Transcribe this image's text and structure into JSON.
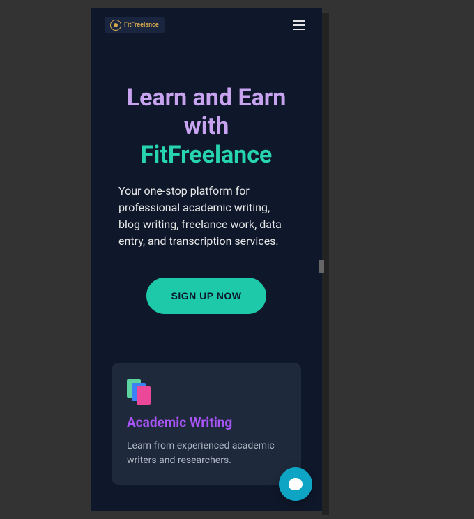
{
  "header": {
    "logo_text": "FitFreelance"
  },
  "hero": {
    "title_line1": "Learn and Earn with",
    "title_line2": "FitFreelance",
    "description": "Your one-stop platform for professional academic writing, blog writing, freelance work, data entry, and transcription services.",
    "cta_label": "SIGN UP NOW"
  },
  "cards": [
    {
      "title": "Academic Writing",
      "description": "Learn from experienced academic writers and researchers."
    }
  ]
}
